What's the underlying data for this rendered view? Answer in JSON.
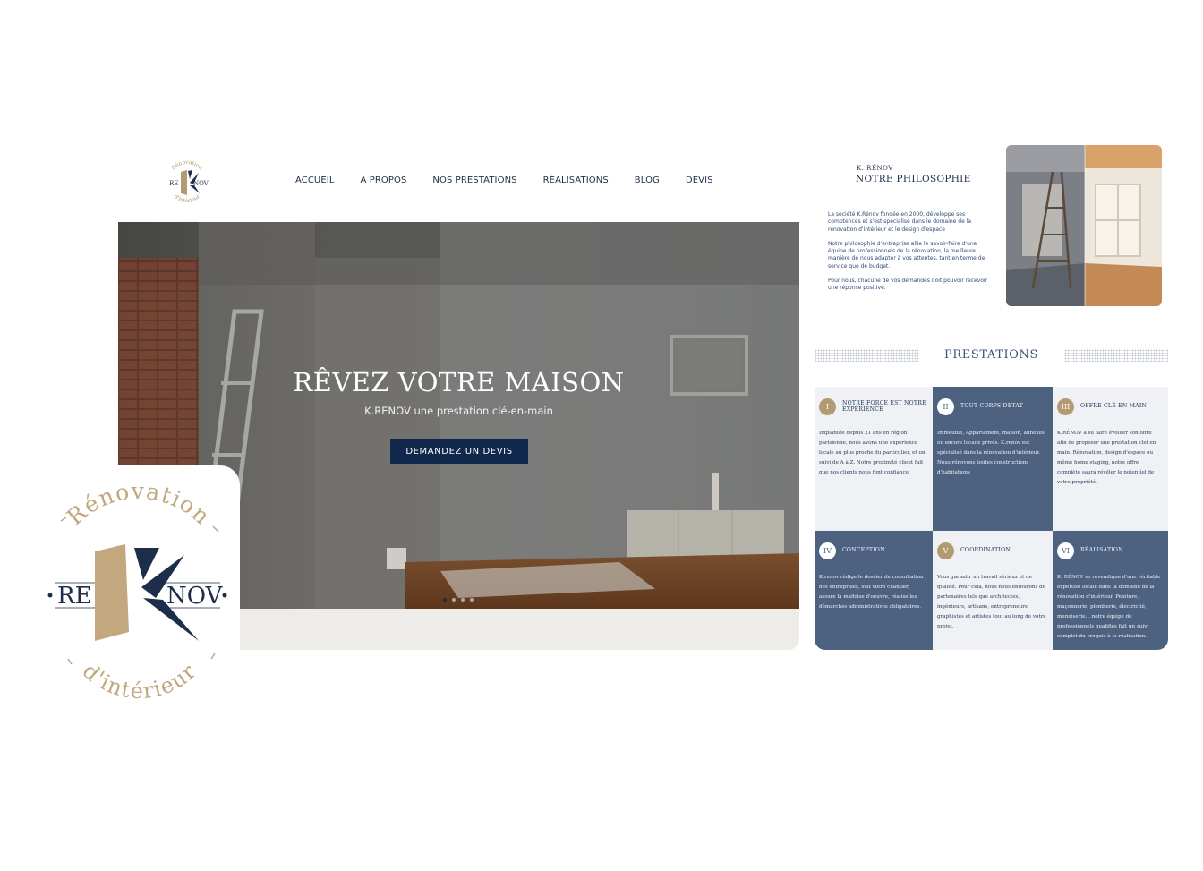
{
  "site": {
    "logo": {
      "top_text": "Rénovation",
      "left_text": "RE",
      "right_text": "NOV",
      "bottom_text": "d'intérieur"
    },
    "nav": [
      "ACCUEIL",
      "A PROPOS",
      "NOS PRESTATIONS",
      "RÉALISATIONS",
      "BLOG",
      "DEVIS"
    ],
    "hero": {
      "title": "RÊVEZ VOTRE MAISON",
      "subtitle": "K.RENOV une prestation clé-en-main",
      "cta": "DEMANDEZ UN DEVIS",
      "slides": 4,
      "active_slide": 1
    }
  },
  "philosophy": {
    "kicker": "K. RÉNOV",
    "title": "NOTRE PHILOSOPHIE",
    "paragraphs": [
      "La société K.Rénov fondée en 2000, développe ses comptences et s'est spécialisé dans le domaine de la rénovation d'intérieur et le design d'espace",
      "Notre philosophie d'entreprise allie le savoir-faire d'une équipe de professionnels de la rénovation, la meilleure manière de nous adapter à vos attentes, tant en terme de service que de budget.",
      "Pour nous, chacune de vos demandes doit pouvoir recevoir une réponse positive."
    ]
  },
  "prestations": {
    "title": "PRESTATIONS",
    "items": [
      {
        "num": "I",
        "title": "NOTRE FORCE  EST NOTRE EXPÉRIENCE",
        "body": "Implantée depuis 21 ans en région parisienne, nous avons une expérience locale au plus proche du particulier, et un suivi de A à Z. Notre proximité client fait que nos clients nous font confiance."
      },
      {
        "num": "II",
        "title": "TOUT CORPS DETAT",
        "body": "Immeuble, Appartement, maison, annexes,  ou encore locaux privés. K.renov est spécialisé dans la rénovation d'intérieur. Nous rénovons toutes constructions d'habitations"
      },
      {
        "num": "III",
        "title": "OFFRE CLÉ EN MAIN",
        "body": "K.RÉNOV a su faire évoluer son offre afin de proposer une prestation clef en main. Rénovation, design d'espace ou même home staging, notre offre complète saura révéler le potentiel de votre propriété."
      },
      {
        "num": "IV",
        "title": "CONCEPTION",
        "body": "K.renov rédige le dossier de consultation des entreprises, suit votre chantier, assure la maitrise d'oeuvre, réalise les démarches administratives obligatoires."
      },
      {
        "num": "V",
        "title": "COORDINATION",
        "body": "Vous  garantir un travail sérieux et de qualité. Pour cela, nous nous entourons de partenaires tels que architectes, ingénieurs, artisans, entrepreneurs, graphistes et artistes  tout au long de votre projet."
      },
      {
        "num": "VI",
        "title": "RÉALISATION",
        "body": "K. RÉNOV se revendique d'une véritable expertise locale  dans la domaine de la rénovation d'intérieur. Peinture, maçonnerie, plomberie, électricité, menuiserie... notre équipe de professionnels qualifiés fait un suivi complet  du croquis à la réalisation."
      }
    ]
  },
  "colors": {
    "navy": "#10284b",
    "slate": "#4d6180",
    "gold": "#b39a72",
    "light": "#eff1f4"
  }
}
